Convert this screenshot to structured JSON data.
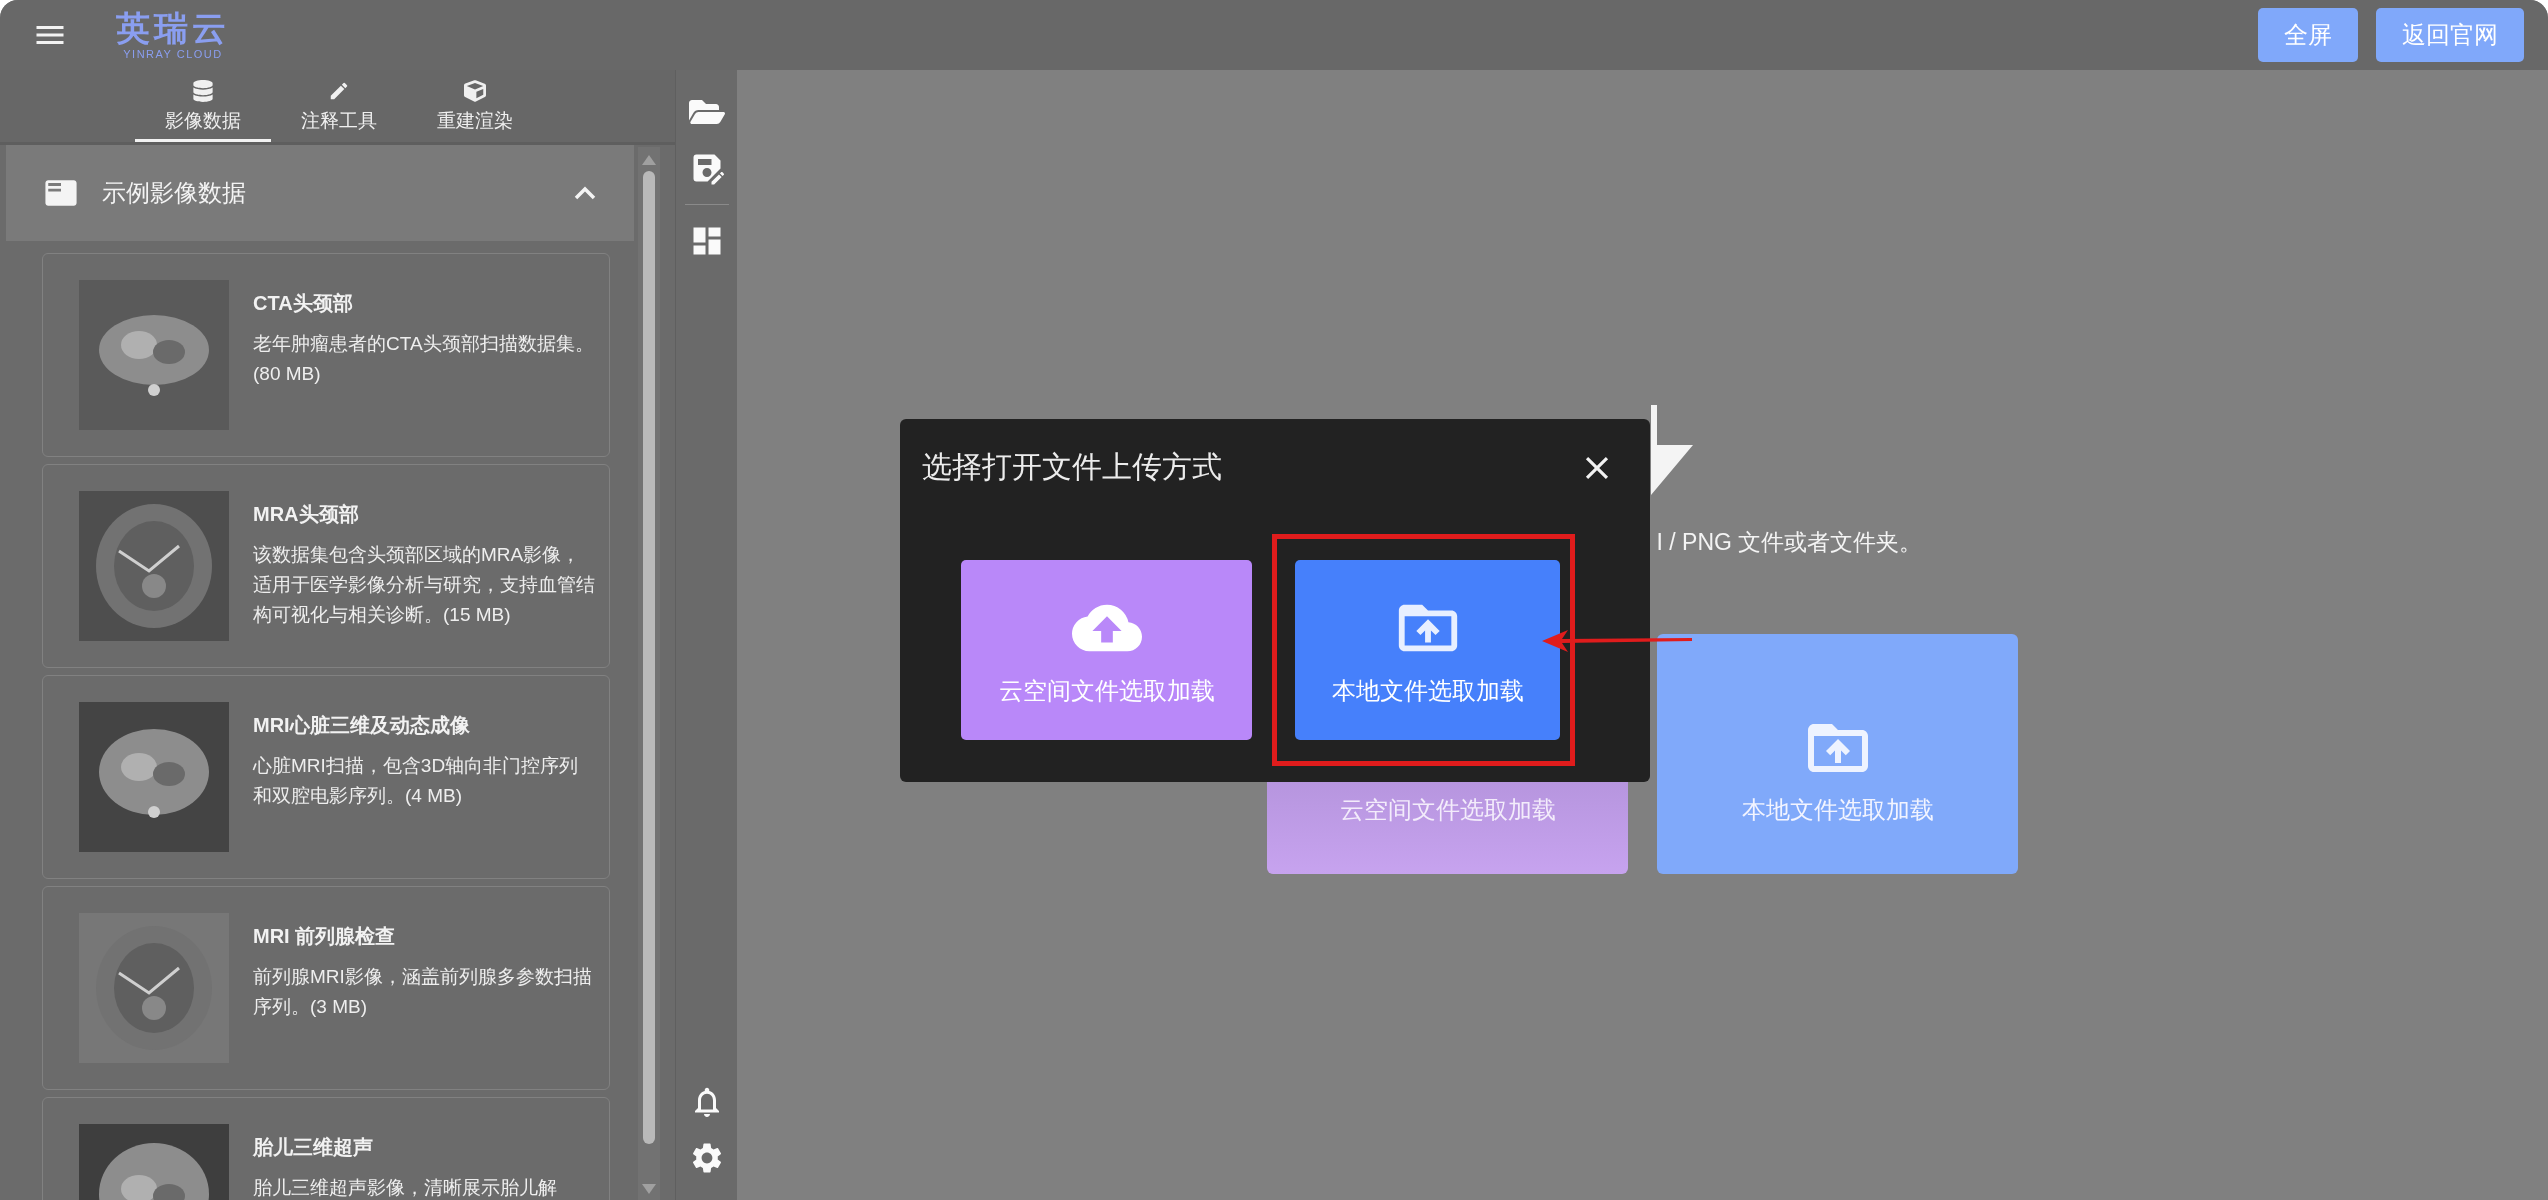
{
  "header": {
    "logo": {
      "name": "英瑞云",
      "subtitle": "YINRAY CLOUD"
    },
    "buttons": [
      "全屏",
      "返回官网"
    ]
  },
  "sidebar": {
    "tabs": [
      {
        "label": "影像数据",
        "selected": true
      },
      {
        "label": "注释工具",
        "selected": false
      },
      {
        "label": "重建渲染",
        "selected": false
      }
    ],
    "section": {
      "title": "示例影像数据",
      "expanded": true
    },
    "datasets": [
      {
        "title": "CTA头颈部",
        "description": "老年肿瘤患者的CTA头颈部扫描数据集。(80 MB)"
      },
      {
        "title": "MRA头颈部",
        "description": "该数据集包含头颈部区域的MRA影像，适用于医学影像分析与研究，支持血管结构可视化与相关诊断。(15 MB)"
      },
      {
        "title": "MRI心脏三维及动态成像",
        "description": "心脏MRI扫描，包含3D轴向非门控序列和双腔电影序列。(4 MB)"
      },
      {
        "title": "MRI 前列腺检查",
        "description": "前列腺MRI影像，涵盖前列腺多参数扫描序列。(3 MB)"
      },
      {
        "title": "胎儿三维超声",
        "description": "胎儿三维超声影像，清晰展示胎儿解"
      }
    ]
  },
  "drop_zone": {
    "hint": "I / PNG 文件或者文件夹。",
    "cards": [
      {
        "kind": "cloud",
        "label": "云空间文件选取加载"
      },
      {
        "kind": "local",
        "label": "本地文件选取加载"
      }
    ]
  },
  "dialog": {
    "title": "选择打开文件上传方式",
    "options": [
      {
        "kind": "cloud",
        "label": "云空间文件选取加载",
        "highlighted": false
      },
      {
        "kind": "local",
        "label": "本地文件选取加载",
        "highlighted": true
      }
    ]
  }
}
